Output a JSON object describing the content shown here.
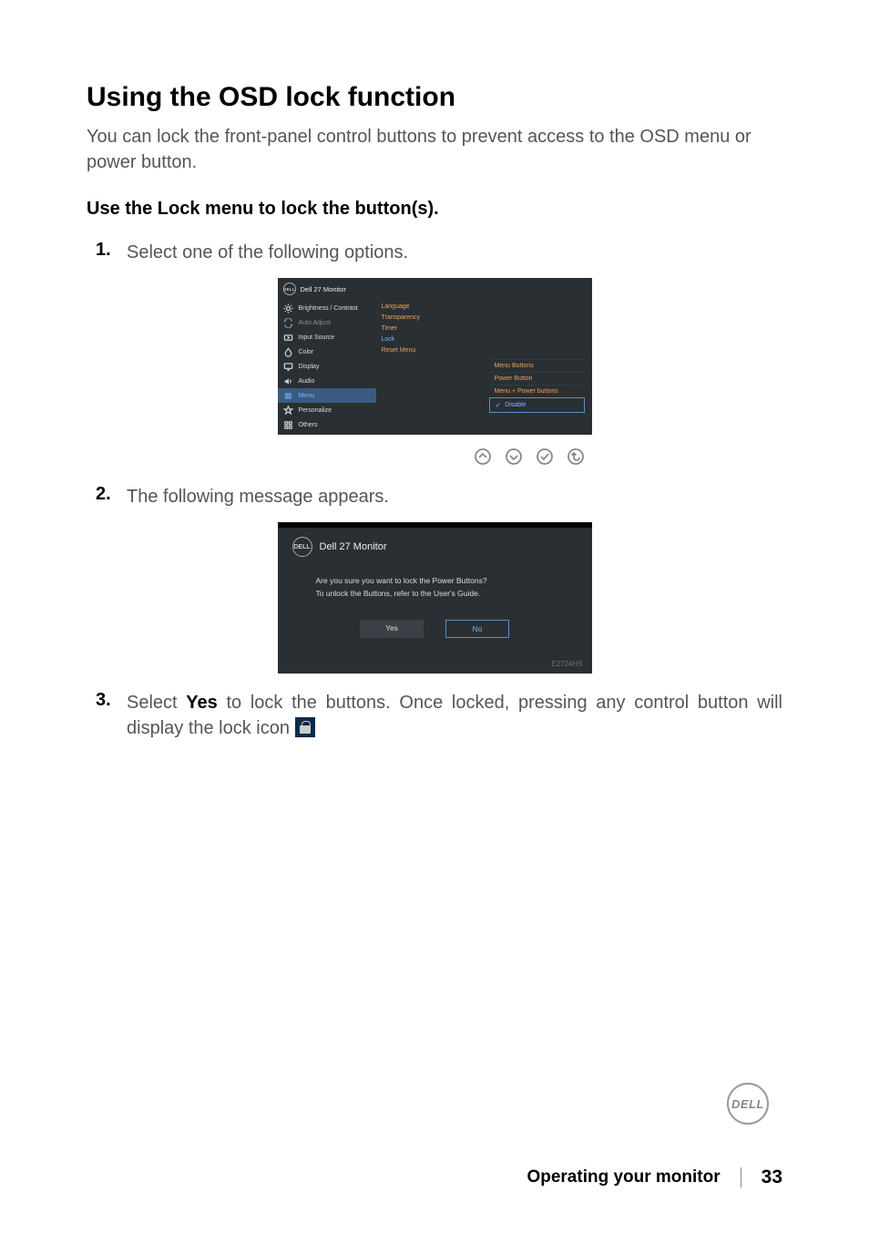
{
  "h1": "Using the OSD lock function",
  "intro": "You can lock the front-panel control buttons to prevent access to the OSD menu or power button.",
  "h2": "Use the Lock menu to lock the button(s).",
  "steps": {
    "s1_num": "1.",
    "s1_text": "Select one of the following options.",
    "s2_num": "2.",
    "s2_text": "The following message appears.",
    "s3_num": "3.",
    "s3_prefix": "Select ",
    "s3_bold": "Yes",
    "s3_rest": " to lock the buttons. Once locked, pressing any control button will display the lock icon "
  },
  "osd1": {
    "brand": "DELL",
    "title": "Dell 27 Monitor",
    "side": [
      "Brightness / Contrast",
      "Auto Adjust",
      "Input Source",
      "Color",
      "Display",
      "Audio",
      "Menu",
      "Personalize",
      "Others"
    ],
    "mid": {
      "language": "Language",
      "transparency": "Transparency",
      "timer": "Timer",
      "lock": "Lock",
      "reset": "Reset Menu"
    },
    "dropdown": {
      "opt1": "Menu Buttons",
      "opt2": "Power Button",
      "opt3": "Menu + Power buttons",
      "opt4": "Disable"
    }
  },
  "osd2": {
    "brand": "DELL",
    "title": "Dell 27 Monitor",
    "line1": "Are you sure you want to lock the Power Buttons?",
    "line2": "To unlock the Buttons, refer to the User's Guide.",
    "yes": "Yes",
    "no": "No",
    "model": "E2724HS"
  },
  "footer": {
    "section": "Operating your monitor",
    "page": "33",
    "brand": "DELL"
  }
}
